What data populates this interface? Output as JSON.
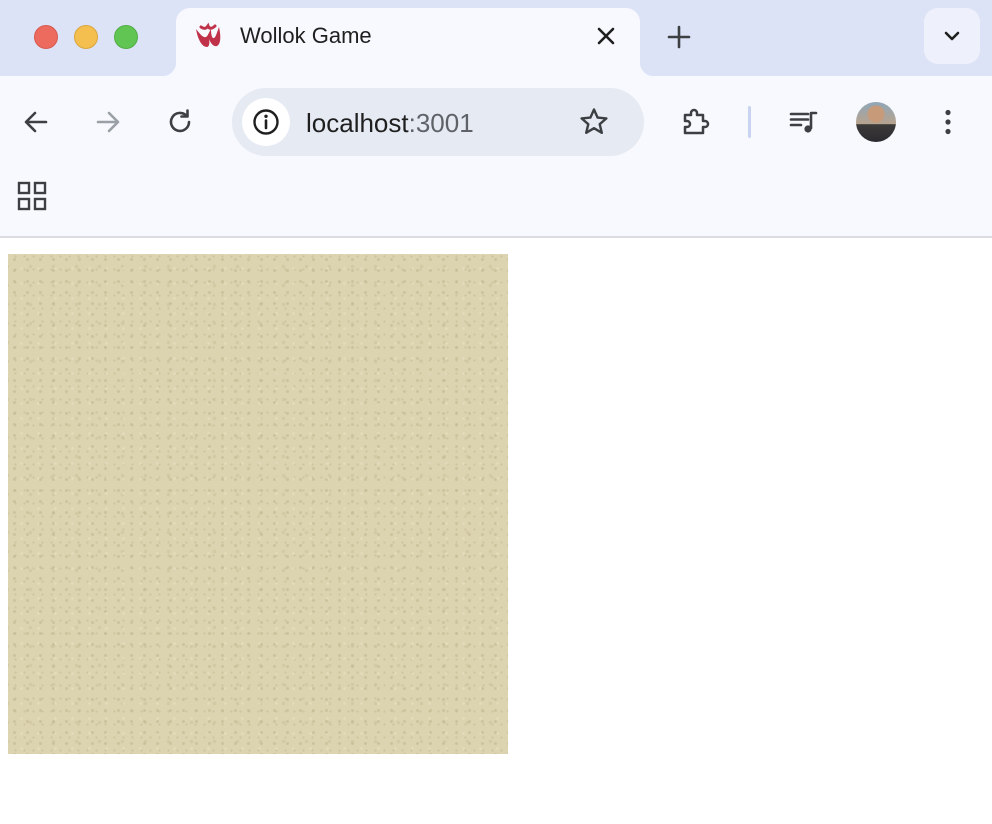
{
  "tab": {
    "title": "Wollok Game",
    "close_icon": "close-icon",
    "favicon": "wollok-logo"
  },
  "toolbar": {
    "back_icon": "arrow-left-icon",
    "forward_icon": "arrow-right-icon",
    "reload_icon": "reload-icon",
    "url_host": "localhost",
    "url_port": ":3001",
    "site_info_icon": "info-icon",
    "bookmark_icon": "star-icon",
    "extensions_icon": "puzzle-icon",
    "media_icon": "playlist-music-icon",
    "menu_icon": "kebab-menu-icon"
  },
  "bookmarks_bar": {
    "apps_icon": "apps-grid-icon"
  },
  "colors": {
    "tabstrip_bg": "#dde3f7",
    "toolbar_bg": "#f8f9fe",
    "board_sand": "#dcd4b0",
    "favicon_red": "#c0324a"
  }
}
